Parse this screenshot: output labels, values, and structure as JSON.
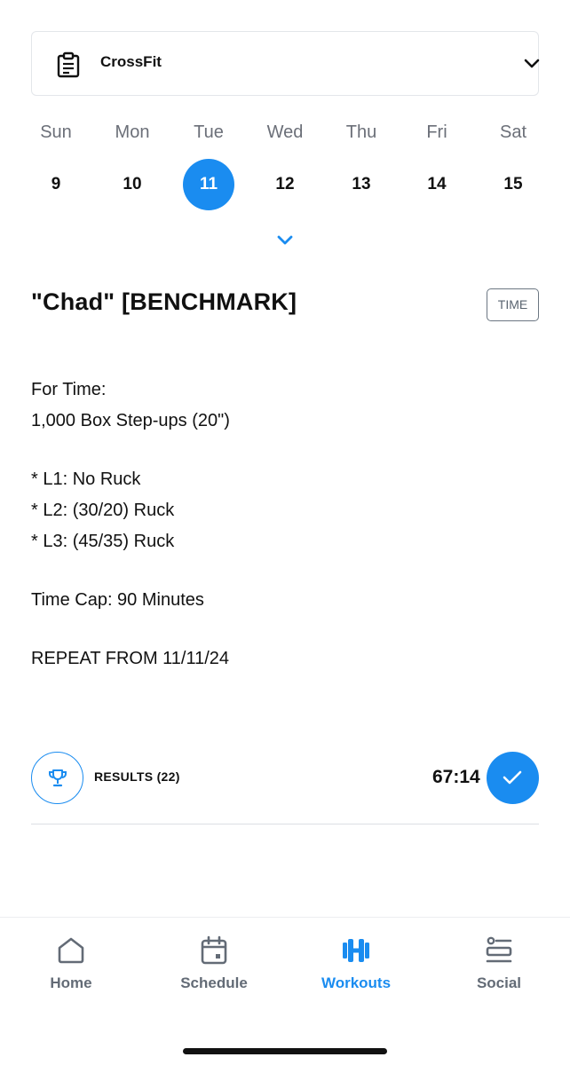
{
  "program": {
    "name": "CrossFit",
    "icon": "clipboard-icon"
  },
  "week": [
    {
      "name": "Sun",
      "num": "9"
    },
    {
      "name": "Mon",
      "num": "10"
    },
    {
      "name": "Tue",
      "num": "11",
      "selected": true
    },
    {
      "name": "Wed",
      "num": "12"
    },
    {
      "name": "Thu",
      "num": "13"
    },
    {
      "name": "Fri",
      "num": "14"
    },
    {
      "name": "Sat",
      "num": "15"
    }
  ],
  "workout": {
    "title": "\"Chad\" [BENCHMARK]",
    "type_badge": "TIME",
    "lines": [
      "For Time:",
      "1,000 Box Step-ups (20\")",
      "* L1: No Ruck",
      "* L2: (30/20) Ruck",
      "* L3: (45/35) Ruck",
      "Time Cap: 90 Minutes",
      "REPEAT FROM 11/11/24"
    ]
  },
  "results": {
    "label": "RESULTS (22)",
    "time": "67:14"
  },
  "tabs": [
    {
      "label": "Home",
      "icon": "home-icon"
    },
    {
      "label": "Schedule",
      "icon": "calendar-icon"
    },
    {
      "label": "Workouts",
      "icon": "dumbbell-icon",
      "active": true
    },
    {
      "label": "Social",
      "icon": "social-feed-icon"
    }
  ],
  "colors": {
    "accent": "#1a8cf0",
    "muted": "#636b76",
    "text": "#111111"
  }
}
